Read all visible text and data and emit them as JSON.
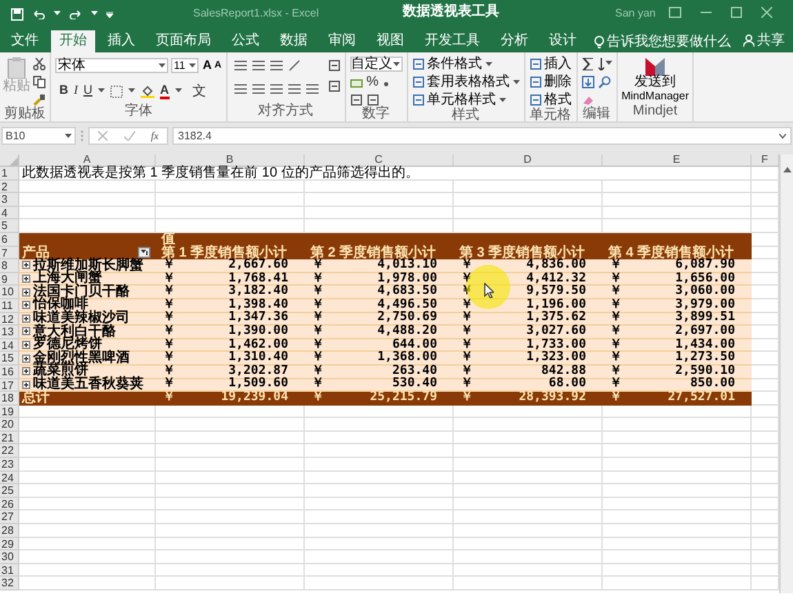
{
  "title_bar": {
    "document": "SalesReport1.xlsx  -  Excel",
    "context_tab": "数据透视表工具",
    "user": "San yan"
  },
  "menu_tabs": [
    {
      "label": "文件",
      "selected": false
    },
    {
      "label": "开始",
      "selected": true
    },
    {
      "label": "插入",
      "selected": false
    },
    {
      "label": "页面布局",
      "selected": false
    },
    {
      "label": "公式",
      "selected": false
    },
    {
      "label": "数据",
      "selected": false
    },
    {
      "label": "审阅",
      "selected": false
    },
    {
      "label": "视图",
      "selected": false
    },
    {
      "label": "开发工具",
      "selected": false
    },
    {
      "label": "分析",
      "selected": false
    },
    {
      "label": "设计",
      "selected": false
    }
  ],
  "tell_me": "告诉我您想要做什么",
  "share": "共享",
  "ribbon": {
    "clipboard": {
      "paste": "粘贴",
      "label": "剪贴板"
    },
    "font": {
      "name": "宋体",
      "size": "11",
      "grow": "A",
      "shrink": "A",
      "styles": [
        "B",
        "I",
        "U"
      ],
      "color_letter": "A",
      "phonetic": "文",
      "label": "字体"
    },
    "alignment": {
      "label": "对齐方式"
    },
    "number": {
      "format": "自定义",
      "percent": "%",
      "label": "数字"
    },
    "styles": {
      "items": [
        "条件格式",
        "套用表格格式",
        "单元格样式"
      ],
      "label": "样式"
    },
    "cells": {
      "items": [
        "插入",
        "删除",
        "格式"
      ],
      "label": "单元格"
    },
    "editing": {
      "label": "编辑"
    },
    "mindjet": {
      "button": [
        "发送到",
        "MindManager"
      ],
      "label": "Mindjet"
    }
  },
  "formula_bar": {
    "name_box": "B10",
    "fx": "fx",
    "formula": "3182.4"
  },
  "sheet": {
    "columns": [
      "A",
      "B",
      "C",
      "D",
      "E",
      "F"
    ],
    "row_numbers": [
      "1",
      "2",
      "3",
      "4",
      "5",
      "6",
      "7",
      "8",
      "9",
      "10",
      "11",
      "12",
      "13",
      "14",
      "15",
      "16",
      "17",
      "18",
      "19",
      "20",
      "21",
      "22",
      "23",
      "24",
      "25",
      "26",
      "27",
      "28",
      "29",
      "30",
      "31",
      "32"
    ],
    "note": "此数据透视表是按第 1 季度销售量在前 10 位的产品筛选得出的。",
    "pivot": {
      "values_label": "值",
      "row_header": "产品",
      "columns": [
        "第 1 季度销售额小计",
        "第 2 季度销售额小计",
        "第 3 季度销售额小计",
        "第 4 季度销售额小计"
      ],
      "rows": [
        {
          "product": "拉斯维加斯长脚蟹",
          "cells": [
            [
              "￥",
              "2,667.60"
            ],
            [
              "￥",
              "4,013.10"
            ],
            [
              "￥",
              "4,836.00"
            ],
            [
              "￥",
              "6,087.90"
            ]
          ]
        },
        {
          "product": "上海大闸蟹",
          "cells": [
            [
              "￥",
              "1,768.41"
            ],
            [
              "￥",
              "1,978.00"
            ],
            [
              "￥",
              "4,412.32"
            ],
            [
              "￥",
              "1,656.00"
            ]
          ]
        },
        {
          "product": "法国卡门贝干酪",
          "cells": [
            [
              "￥",
              "3,182.40"
            ],
            [
              "￥",
              "4,683.50"
            ],
            [
              "￥",
              "9,579.50"
            ],
            [
              "￥",
              "3,060.00"
            ]
          ]
        },
        {
          "product": "怡保咖啡",
          "cells": [
            [
              "￥",
              "1,398.40"
            ],
            [
              "￥",
              "4,496.50"
            ],
            [
              "￥",
              "1,196.00"
            ],
            [
              "￥",
              "3,979.00"
            ]
          ]
        },
        {
          "product": "味道美辣椒沙司",
          "cells": [
            [
              "￥",
              "1,347.36"
            ],
            [
              "￥",
              "2,750.69"
            ],
            [
              "￥",
              "1,375.62"
            ],
            [
              "￥",
              "3,899.51"
            ]
          ]
        },
        {
          "product": "意大利白干酪",
          "cells": [
            [
              "￥",
              "1,390.00"
            ],
            [
              "￥",
              "4,488.20"
            ],
            [
              "￥",
              "3,027.60"
            ],
            [
              "￥",
              "2,697.00"
            ]
          ]
        },
        {
          "product": "罗德尼烤饼",
          "cells": [
            [
              "￥",
              "1,462.00"
            ],
            [
              "￥",
              "644.00"
            ],
            [
              "￥",
              "1,733.00"
            ],
            [
              "￥",
              "1,434.00"
            ]
          ]
        },
        {
          "product": "金刚烈性黑啤酒",
          "cells": [
            [
              "￥",
              "1,310.40"
            ],
            [
              "￥",
              "1,368.00"
            ],
            [
              "￥",
              "1,323.00"
            ],
            [
              "￥",
              "1,273.50"
            ]
          ]
        },
        {
          "product": "蔬菜煎饼",
          "cells": [
            [
              "￥",
              "3,202.87"
            ],
            [
              "￥",
              "263.40"
            ],
            [
              "￥",
              "842.88"
            ],
            [
              "￥",
              "2,590.10"
            ]
          ]
        },
        {
          "product": "味道美五香秋葵荚",
          "cells": [
            [
              "￥",
              "1,509.60"
            ],
            [
              "￥",
              "530.40"
            ],
            [
              "￥",
              "68.00"
            ],
            [
              "￥",
              "850.00"
            ]
          ]
        }
      ],
      "total": {
        "label": "总计",
        "cells": [
          [
            "￥",
            "19,239.04"
          ],
          [
            "￥",
            "25,215.79"
          ],
          [
            "￥",
            "28,393.92"
          ],
          [
            "￥",
            "27,527.01"
          ]
        ]
      }
    }
  }
}
